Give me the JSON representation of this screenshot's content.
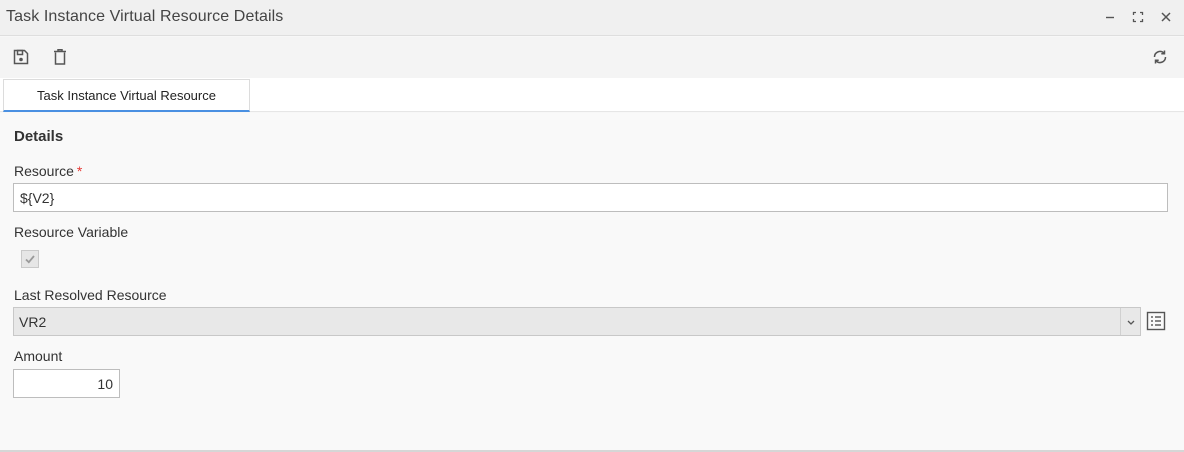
{
  "window": {
    "title": "Task Instance Virtual Resource Details",
    "controls": [
      "minimize-icon",
      "maximize-icon",
      "close-icon"
    ]
  },
  "toolbar": {
    "buttons": [
      "save-icon",
      "delete-icon"
    ],
    "refresh": "refresh-icon"
  },
  "tabs": [
    {
      "label": "Task Instance Virtual Resource",
      "active": true
    }
  ],
  "details": {
    "section_title": "Details",
    "resource_label": "Resource",
    "required_marker": "*",
    "resource_value": "${V2}",
    "resource_variable_label": "Resource Variable",
    "resource_variable_checked": true,
    "last_resolved_label": "Last Resolved Resource",
    "last_resolved_value": "VR2",
    "amount_label": "Amount",
    "amount_value": "10"
  },
  "colors": {
    "accent": "#4a90e2",
    "required": "#e53935"
  }
}
